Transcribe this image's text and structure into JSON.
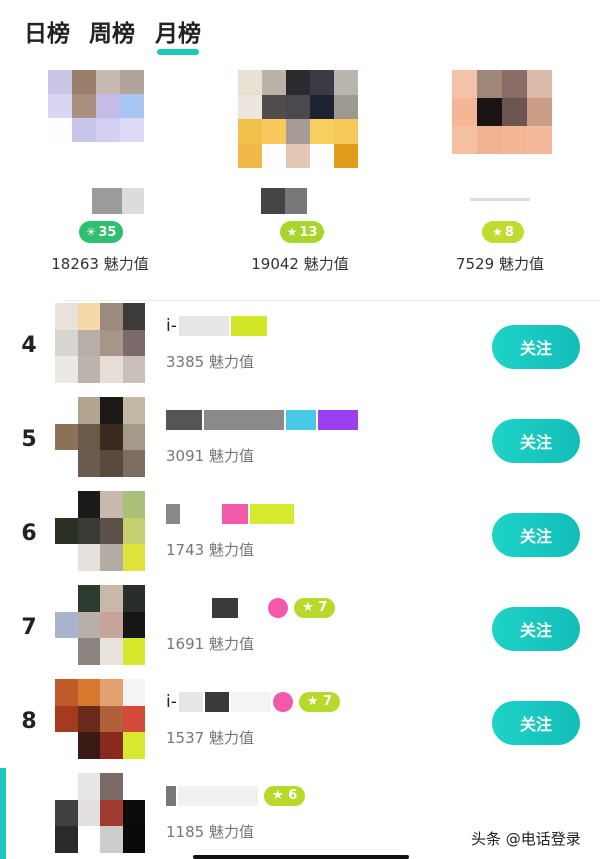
{
  "tabs": [
    {
      "label": "日榜"
    },
    {
      "label": "周榜"
    },
    {
      "label": "月榜"
    }
  ],
  "active_tab": "月榜",
  "top3": [
    {
      "badge": "35",
      "badge_icon": "sun-icon",
      "badge_color": "#2ec06e",
      "score": "18263 魅力值"
    },
    {
      "badge": "13",
      "badge_icon": "star-icon",
      "badge_color": "#a8d62c",
      "score": "19042 魅力值"
    },
    {
      "badge": "8",
      "badge_icon": "star-icon",
      "badge_color": "#c2db33",
      "score": "7529 魅力值"
    }
  ],
  "list": [
    {
      "rank": "4",
      "name_text": "i-",
      "score": "3385 魅力值",
      "follow": "关注"
    },
    {
      "rank": "5",
      "name_text": "",
      "score": "3091 魅力值",
      "follow": "关注"
    },
    {
      "rank": "6",
      "name_text": "",
      "score": "1743 魅力值",
      "follow": "关注"
    },
    {
      "rank": "7",
      "name_text": "",
      "level": "7",
      "score": "1691 魅力值",
      "follow": "关注"
    },
    {
      "rank": "8",
      "name_text": "i-",
      "level": "7",
      "score": "1537 魅力值",
      "follow": "关注"
    },
    {
      "rank": "",
      "name_text": "",
      "level": "6",
      "score": "1185 魅力值"
    }
  ],
  "colors": {
    "accent": "#19c9bd",
    "level_badge": "#b7d92a"
  },
  "watermark": "头条 @电话登录"
}
